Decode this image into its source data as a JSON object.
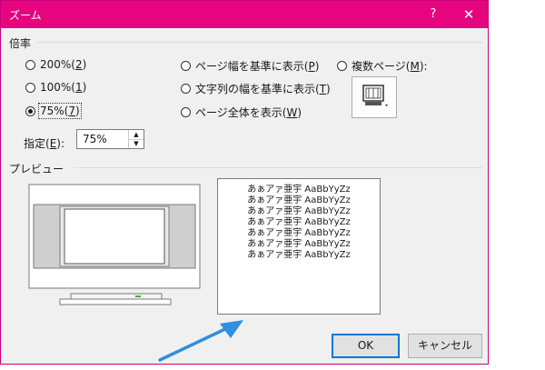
{
  "window": {
    "title": "ズーム",
    "help": "?",
    "close": "✕"
  },
  "zoom_group": {
    "label": "倍率",
    "options": [
      {
        "label": "200%(",
        "key": "2",
        "suffix": ")",
        "checked": false
      },
      {
        "label": "100%(",
        "key": "1",
        "suffix": ")",
        "checked": false
      },
      {
        "label": "75%(",
        "key": "7",
        "suffix": ")",
        "checked": true
      },
      {
        "label": "ページ幅を基準に表示(",
        "key": "P",
        "suffix": ")",
        "checked": false
      },
      {
        "label": "文字列の幅を基準に表示(",
        "key": "T",
        "suffix": ")",
        "checked": false
      },
      {
        "label": "ページ全体を表示(",
        "key": "W",
        "suffix": ")",
        "checked": false
      },
      {
        "label": "複数ページ(",
        "key": "M",
        "suffix": "):",
        "checked": false
      }
    ],
    "spec": {
      "label": "指定(",
      "key": "E",
      "suffix": "):",
      "value": "75%"
    }
  },
  "preview": {
    "label": "プレビュー",
    "sample_lines": [
      "あぁアァ亜宇 AaBbYyZz",
      "あぁアァ亜宇 AaBbYyZz",
      "あぁアァ亜宇 AaBbYyZz",
      "あぁアァ亜宇 AaBbYyZz",
      "あぁアァ亜宇 AaBbYyZz",
      "あぁアァ亜宇 AaBbYyZz",
      "あぁアァ亜宇 AaBbYyZz"
    ]
  },
  "buttons": {
    "ok": "OK",
    "cancel": "キャンセル"
  },
  "colors": {
    "titlebar": "#e6047f",
    "arrow": "#2f8fe0"
  }
}
